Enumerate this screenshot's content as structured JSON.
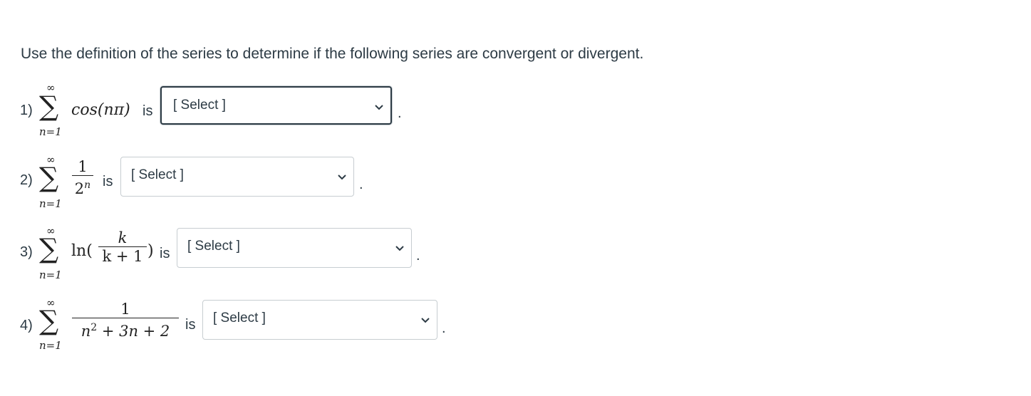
{
  "instruction": "Use the definition of the series to determine if the following series are convergent or divergent.",
  "questions": [
    {
      "number": "1)",
      "sum_upper": "∞",
      "sum_lower": "n=1",
      "term": "cos(nπ)",
      "is_label": "is",
      "select_value": "[ Select ]",
      "end": "."
    },
    {
      "number": "2)",
      "sum_upper": "∞",
      "sum_lower": "n=1",
      "numerator": "1",
      "denominator_base": "2",
      "denominator_exp": "n",
      "is_label": "is",
      "select_value": "[ Select ]",
      "end": "."
    },
    {
      "number": "3)",
      "sum_upper": "∞",
      "sum_lower": "n=1",
      "fn": "ln(",
      "numerator": "k",
      "denominator": "k + 1",
      "close": ")",
      "is_label": "is",
      "select_value": "[ Select ]",
      "end": "."
    },
    {
      "number": "4)",
      "sum_upper": "∞",
      "sum_lower": "n=1",
      "numerator": "1",
      "denominator_a": "n",
      "denominator_a_exp": "2",
      "denominator_b": " + 3n + 2",
      "is_label": "is",
      "select_value": "[ Select ]",
      "end": "."
    }
  ],
  "icons": {
    "dropdown": "chevron-down-icon"
  }
}
